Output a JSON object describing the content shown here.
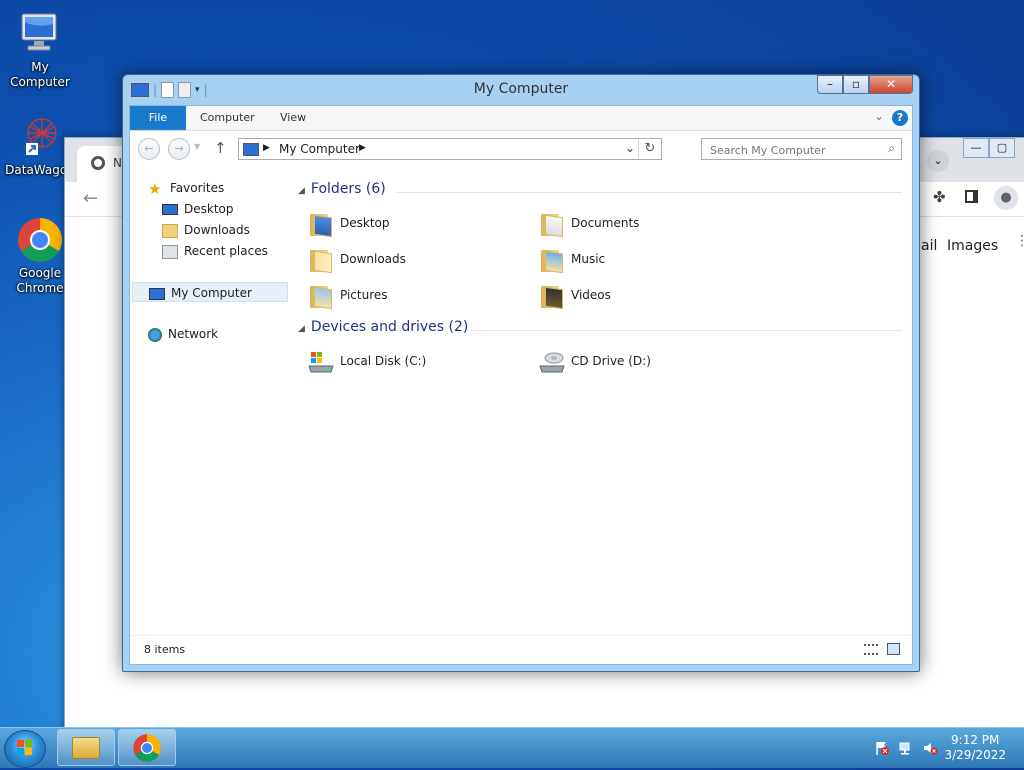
{
  "desktop": {
    "icons": [
      {
        "label": "My Computer",
        "icon": "computer-icon"
      },
      {
        "label": "DataWagon",
        "icon": "datawagon-icon"
      },
      {
        "label": "Google Chrome",
        "icon": "chrome-icon"
      }
    ]
  },
  "background_browser": {
    "tab_initial": "N",
    "images_label": "Images",
    "mail_fragment": "ail"
  },
  "explorer": {
    "title": "My Computer",
    "ribbon_tabs": [
      "File",
      "Computer",
      "View"
    ],
    "help_label": "?",
    "address": "My Computer",
    "search_placeholder": "Search My Computer",
    "nav": {
      "favorites": "Favorites",
      "favorite_items": [
        "Desktop",
        "Downloads",
        "Recent places"
      ],
      "computer": "My Computer",
      "network": "Network"
    },
    "folders_header": "Folders (6)",
    "folders": [
      "Desktop",
      "Documents",
      "Downloads",
      "Music",
      "Pictures",
      "Videos"
    ],
    "drives_header": "Devices and drives (2)",
    "drives": [
      "Local Disk (C:)",
      "CD Drive (D:)"
    ],
    "status": "8 items"
  },
  "taskbar": {
    "time": "9:12 PM",
    "date": "3/29/2022"
  },
  "colors": {
    "accent": "#1979ca",
    "group_header": "#1e3287",
    "close_button": "#c7442a"
  }
}
